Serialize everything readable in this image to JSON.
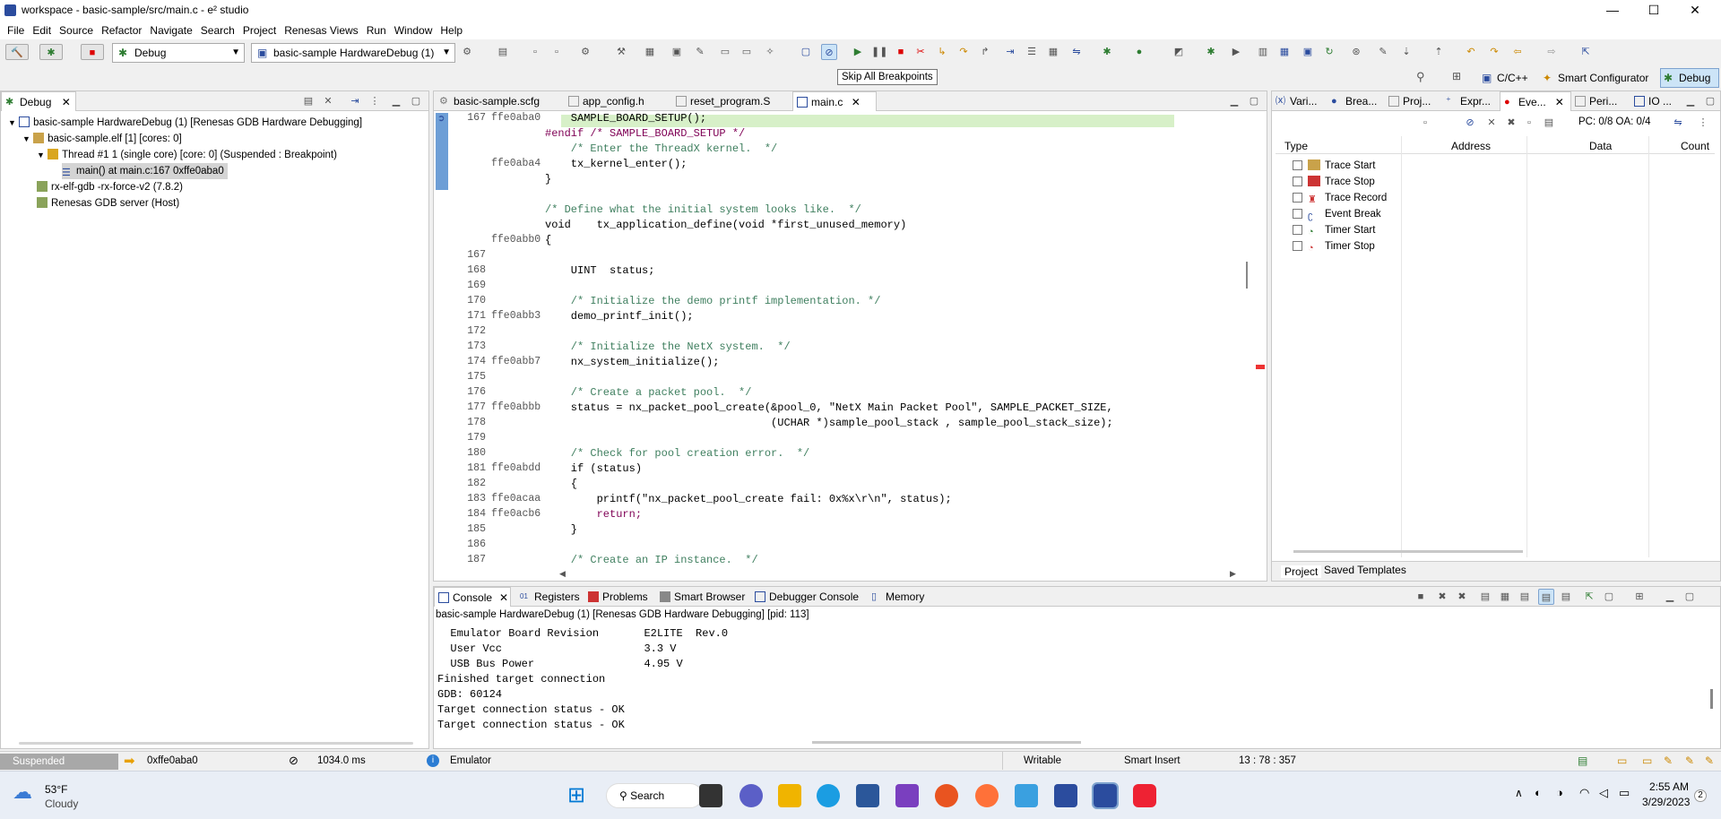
{
  "window": {
    "title": "workspace - basic-sample/src/main.c - e² studio",
    "min": "—",
    "max": "☐",
    "close": "✕"
  },
  "menu": [
    "File",
    "Edit",
    "Source",
    "Refactor",
    "Navigate",
    "Search",
    "Project",
    "Renesas Views",
    "Run",
    "Window",
    "Help"
  ],
  "toolbar": {
    "launch_mode": "Debug",
    "launch_config": "basic-sample HardwareDebug (1)",
    "tooltip": "Skip All Breakpoints"
  },
  "perspectives": {
    "cpp": "C/C++",
    "smart": "Smart Configurator",
    "debug": "Debug"
  },
  "debug_view": {
    "tab": "Debug",
    "items": [
      "basic-sample HardwareDebug (1) [Renesas GDB Hardware Debugging]",
      "basic-sample.elf [1] [cores: 0]",
      "Thread #1 1 (single core) [core: 0] (Suspended : Breakpoint)",
      "main() at main.c:167 0xffe0aba0",
      "rx-elf-gdb  -rx-force-v2 (7.8.2)",
      "Renesas GDB server (Host)"
    ]
  },
  "editor": {
    "tabs": [
      "basic-sample.scfg",
      "app_config.h",
      "reset_program.S",
      "main.c"
    ],
    "lines": [
      {
        "n": "167",
        "a": "ffe0aba0",
        "t": "    SAMPLE_BOARD_SETUP();",
        "hl": true
      },
      {
        "n": "",
        "a": "",
        "t": "#endif /* SAMPLE_BOARD_SETUP */",
        "c": "pp"
      },
      {
        "n": "",
        "a": "",
        "t": "    /* Enter the ThreadX kernel.  */",
        "c": "cm"
      },
      {
        "n": "",
        "a": "ffe0aba4",
        "t": "    tx_kernel_enter();"
      },
      {
        "n": "",
        "a": "",
        "t": "}"
      },
      {
        "n": "",
        "a": "",
        "t": ""
      },
      {
        "n": "",
        "a": "",
        "t": "/* Define what the initial system looks like.  */",
        "c": "cm"
      },
      {
        "n": "",
        "a": "",
        "t": "void    tx_application_define(void *first_unused_memory)",
        "c": "fn"
      },
      {
        "n": "",
        "a": "ffe0abb0",
        "t": "{"
      },
      {
        "n": "167",
        "a": "",
        "t": ""
      },
      {
        "n": "168",
        "a": "",
        "t": "    UINT  status;"
      },
      {
        "n": "169",
        "a": "",
        "t": ""
      },
      {
        "n": "170",
        "a": "",
        "t": "    /* Initialize the demo printf implementation. */",
        "c": "cm"
      },
      {
        "n": "171",
        "a": "ffe0abb3",
        "t": "    demo_printf_init();"
      },
      {
        "n": "172",
        "a": "",
        "t": ""
      },
      {
        "n": "173",
        "a": "",
        "t": "    /* Initialize the NetX system.  */",
        "c": "cm"
      },
      {
        "n": "174",
        "a": "ffe0abb7",
        "t": "    nx_system_initialize();"
      },
      {
        "n": "175",
        "a": "",
        "t": ""
      },
      {
        "n": "176",
        "a": "",
        "t": "    /* Create a packet pool.  */",
        "c": "cm"
      },
      {
        "n": "177",
        "a": "ffe0abbb",
        "t": "    status = nx_packet_pool_create(&pool_0, \"NetX Main Packet Pool\", SAMPLE_PACKET_SIZE,",
        "c": "pool"
      },
      {
        "n": "178",
        "a": "",
        "t": "                                   (UCHAR *)sample_pool_stack , sample_pool_stack_size);"
      },
      {
        "n": "179",
        "a": "",
        "t": ""
      },
      {
        "n": "180",
        "a": "",
        "t": "    /* Check for pool creation error.  */",
        "c": "cm"
      },
      {
        "n": "181",
        "a": "ffe0abdd",
        "t": "    if (status)",
        "c": "if"
      },
      {
        "n": "182",
        "a": "",
        "t": "    {"
      },
      {
        "n": "183",
        "a": "ffe0acaa",
        "t": "        printf(\"nx_packet_pool_create fail: 0x%x\\r\\n\", status);",
        "c": "printf"
      },
      {
        "n": "184",
        "a": "ffe0acb6",
        "t": "        return;",
        "c": "ret"
      },
      {
        "n": "185",
        "a": "",
        "t": "    }"
      },
      {
        "n": "186",
        "a": "",
        "t": ""
      },
      {
        "n": "187",
        "a": "",
        "t": "    /* Create an IP instance.  */",
        "c": "cm"
      }
    ]
  },
  "right_panel": {
    "tabs": [
      "Vari...",
      "Brea...",
      "Proj...",
      "Expr...",
      "Eve...",
      "Peri...",
      "IO ..."
    ],
    "status": "PC: 0/8 OA: 0/4",
    "columns": [
      "Type",
      "Address",
      "Data",
      "Count"
    ],
    "events": [
      "Trace Start",
      "Trace Stop",
      "Trace Record",
      "Event Break",
      "Timer Start",
      "Timer Stop"
    ],
    "bottom_tabs": [
      "Project",
      "Saved Templates"
    ]
  },
  "console": {
    "tabs": [
      "Console",
      "Registers",
      "Problems",
      "Smart Browser",
      "Debugger Console",
      "Memory"
    ],
    "header": "basic-sample HardwareDebug (1) [Renesas GDB Hardware Debugging] [pid: 113]",
    "lines": [
      "  Emulator Board Revision       E2LITE  Rev.0",
      "  User Vcc                      3.3 V",
      "  USB Bus Power                 4.95 V",
      "Finished target connection",
      "GDB: 60124",
      "Target connection status - OK",
      "Target connection status - OK"
    ]
  },
  "statusbar": {
    "state": "Suspended",
    "pc": "0xffe0aba0",
    "time": "1034.0 ms",
    "target": "Emulator",
    "writable": "Writable",
    "insert": "Smart Insert",
    "pos": "13 : 78 : 357"
  },
  "taskbar": {
    "temp": "53°F",
    "weather": "Cloudy",
    "search": "Search",
    "time": "2:55 AM",
    "date": "3/29/2023",
    "badge": "2"
  }
}
